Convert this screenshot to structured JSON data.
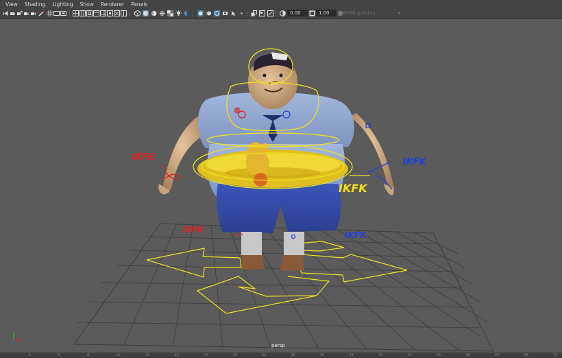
{
  "menu": {
    "items": [
      {
        "label": "View"
      },
      {
        "label": "Shading"
      },
      {
        "label": "Lighting"
      },
      {
        "label": "Show"
      },
      {
        "label": "Renderer"
      },
      {
        "label": "Panels"
      }
    ]
  },
  "toolbar": {
    "exposure_value": "0.00",
    "gamma_value": "1.00",
    "color_space": "sRGB gamma"
  },
  "viewport": {
    "camera_label": "persp",
    "switch_labels": {
      "right_arm": "IKFK",
      "left_arm": "IKFK",
      "spine": "IKFK",
      "right_leg": "IKFK",
      "left_leg": "IKFK"
    },
    "colors": {
      "background": "#5b5b5b",
      "grid": "#3d3d3d",
      "control_yellow": "#f0e020",
      "control_red": "#e02020",
      "control_blue": "#2040e0"
    }
  },
  "ruler": {
    "ticks": [
      "1",
      "4",
      "8",
      "12",
      "16",
      "20",
      "24",
      "28",
      "32",
      "36",
      "40",
      "44",
      "48",
      "52",
      "56",
      "60",
      "64",
      "68",
      "72",
      "76"
    ]
  }
}
